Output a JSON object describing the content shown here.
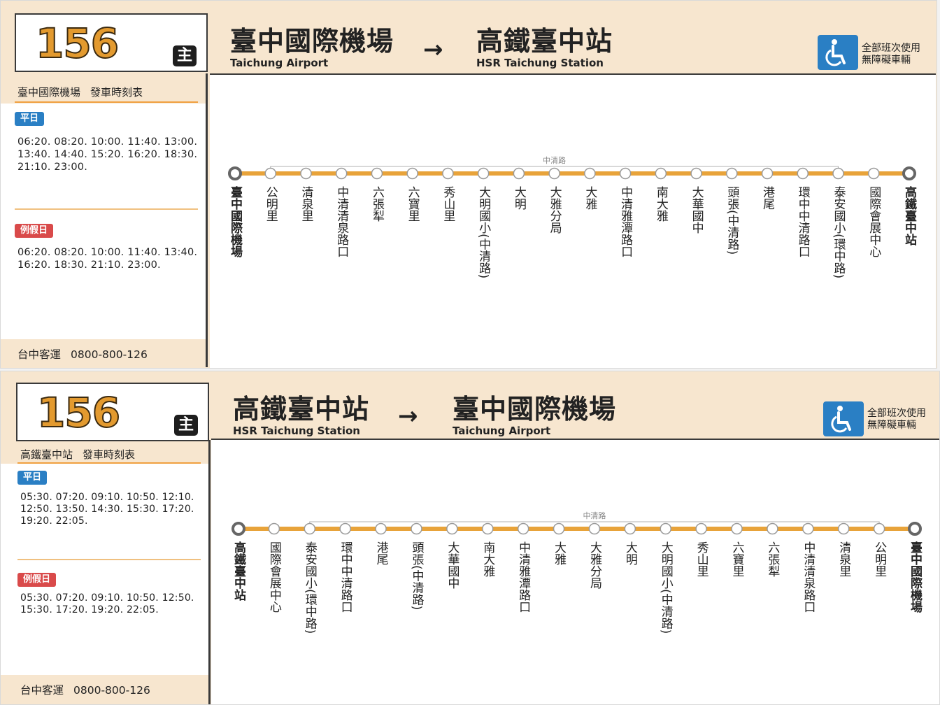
{
  "colors": {
    "accent": "#e8a33a",
    "weekday_tag": "#2a7fc4",
    "holiday_tag": "#d94a4a",
    "panel_bg": "#f7e6cf"
  },
  "icons": {
    "arrow": "right-arrow-icon",
    "access": "wheelchair-icon"
  },
  "top": {
    "route_number": "156",
    "badge": "主",
    "schedule_title": "臺中國際機場",
    "schedule_suffix": "發車時刻表",
    "weekday_label": "平日",
    "weekday_times": "06:20. 08:20. 10:00. 11:40. 13:00. 13:40. 14:40. 15:20. 16:20. 18:30. 21:10. 23:00.",
    "holiday_label": "例假日",
    "holiday_times": "06:20. 08:20. 10:00. 11:40. 13:40. 16:20. 18:30. 21:10. 23:00.",
    "company": "台中客運",
    "phone": "0800-800-126",
    "from_zh": "臺中國際機場",
    "from_en": "Taichung Airport",
    "arrow": "→",
    "to_zh": "高鐵臺中站",
    "to_en": "HSR Taichung Station",
    "access_line1": "全部班次使用",
    "access_line2": "無障礙車輛",
    "road_label": "中清路",
    "stops": [
      "臺中國際機場",
      "公明里",
      "清泉里",
      "中清清泉路口",
      "六張犁",
      "六寶里",
      "秀山里",
      "大明國小(中清路)",
      "大明",
      "大雅分局",
      "大雅",
      "中清雅潭路口",
      "南大雅",
      "大華國中",
      "頭張(中清路)",
      "港尾",
      "環中中清路口",
      "泰安國小(環中路)",
      "國際會展中心",
      "高鐵臺中站"
    ]
  },
  "bottom": {
    "route_number": "156",
    "badge": "主",
    "schedule_title": "高鐵臺中站",
    "schedule_suffix": "發車時刻表",
    "weekday_label": "平日",
    "weekday_times": "05:30. 07:20. 09:10. 10:50. 12:10. 12:50. 13:50. 14:30. 15:30. 17:20. 19:20. 22:05.",
    "holiday_label": "例假日",
    "holiday_times": "05:30. 07:20. 09:10. 10:50. 12:50. 15:30. 17:20. 19:20. 22:05.",
    "company": "台中客運",
    "phone": "0800-800-126",
    "from_zh": "高鐵臺中站",
    "from_en": "HSR Taichung Station",
    "arrow": "→",
    "to_zh": "臺中國際機場",
    "to_en": "Taichung Airport",
    "access_line1": "全部班次使用",
    "access_line2": "無障礙車輛",
    "road_label": "中清路",
    "stops": [
      "高鐵臺中站",
      "國際會展中心",
      "泰安國小(環中路)",
      "環中中清路口",
      "港尾",
      "頭張(中清路)",
      "大華國中",
      "南大雅",
      "中清雅潭路口",
      "大雅",
      "大雅分局",
      "大明",
      "大明國小(中清路)",
      "秀山里",
      "六寶里",
      "六張犁",
      "中清清泉路口",
      "清泉里",
      "公明里",
      "臺中國際機場"
    ]
  }
}
